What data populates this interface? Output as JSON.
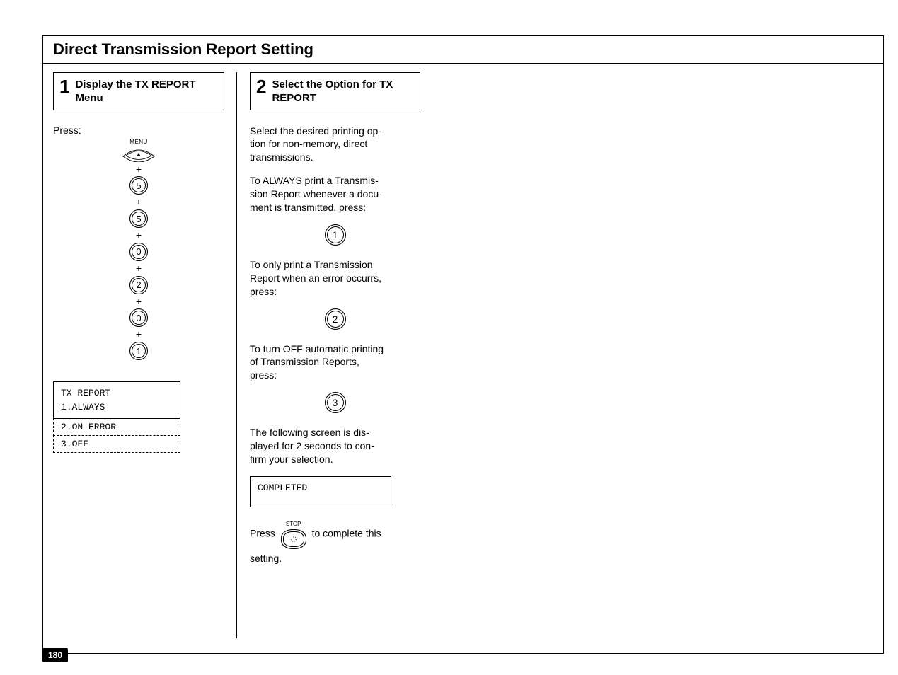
{
  "section_title": "Direct Transmission Report Setting",
  "page_number": "180",
  "col1": {
    "step_num": "1",
    "step_title": "Display the TX REPORT Menu",
    "press_label": "Press:",
    "menu_label": "MENU",
    "menu_triangle": "▲",
    "keys": [
      "5",
      "5",
      "0",
      "2",
      "0",
      "1"
    ],
    "plus": "+",
    "lcd_line1": "TX REPORT",
    "lcd_line2": "1.ALWAYS",
    "lcd_hidden2": "2.ON ERROR",
    "lcd_hidden3": "3.OFF"
  },
  "col2": {
    "step_num": "2",
    "step_title": "Select the Option for TX REPORT",
    "p1": "Select the desired printing op-\ntion for non-memory, direct\ntransmissions.",
    "p2": "To ALWAYS print a Transmis-\nsion Report whenever a docu-\nment is transmitted, press:",
    "key1": "1",
    "p3": "To only print a Transmission\nReport when an error occurrs,\npress:",
    "key2": "2",
    "p4": "To turn OFF automatic printing\nof Transmission Reports,\npress:",
    "key3": "3",
    "p5": "The following screen is dis-\nplayed for 2 seconds to con-\nfirm your selection.",
    "lcd_completed": "COMPLETED",
    "stop_label": "STOP",
    "press_word": "Press",
    "complete_tail": "to complete this",
    "setting_word": "setting."
  }
}
